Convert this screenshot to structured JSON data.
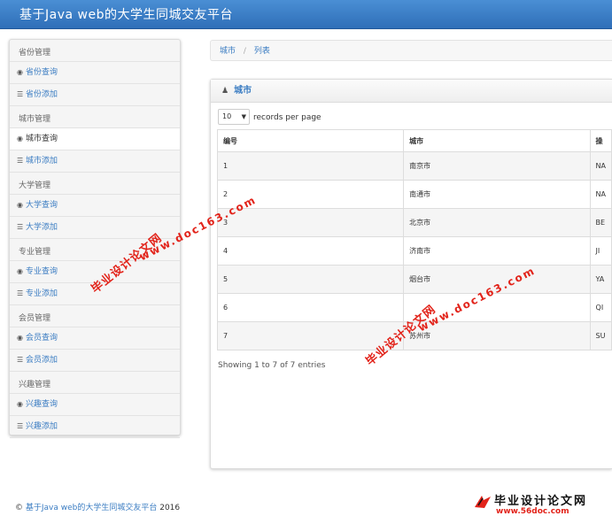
{
  "header": {
    "title": "基于Java web的大学生同城交友平台"
  },
  "sidebar": {
    "groups": [
      {
        "title": "省份管理",
        "items": [
          "省份查询",
          "省份添加"
        ]
      },
      {
        "title": "城市管理",
        "items": [
          "城市查询",
          "城市添加"
        ]
      },
      {
        "title": "大学管理",
        "items": [
          "大学查询",
          "大学添加"
        ]
      },
      {
        "title": "专业管理",
        "items": [
          "专业查询",
          "专业添加"
        ]
      },
      {
        "title": "会员管理",
        "items": [
          "会员查询",
          "会员添加"
        ]
      },
      {
        "title": "兴趣管理",
        "items": [
          "兴趣查询",
          "兴趣添加"
        ]
      }
    ],
    "active_item": "城市查询"
  },
  "breadcrumb": {
    "items": [
      "城市",
      "列表"
    ],
    "separator": "/"
  },
  "panel": {
    "title": "城市",
    "page_length": "10",
    "records_label": "records per page",
    "columns": [
      "编号",
      "城市",
      "操"
    ],
    "rows": [
      [
        "1",
        "南京市",
        "NA"
      ],
      [
        "2",
        "南通市",
        "NA"
      ],
      [
        "3",
        "北京市",
        "BE"
      ],
      [
        "4",
        "济南市",
        "JI"
      ],
      [
        "5",
        "烟台市",
        "YA"
      ],
      [
        "6",
        "",
        "QI"
      ],
      [
        "7",
        "苏州市",
        "SU"
      ]
    ],
    "info": "Showing 1 to 7 of 7 entries"
  },
  "footer": {
    "copyright": "©",
    "link_text": "基于Java web的大学生同城交友平台",
    "year": "2016"
  },
  "watermarks": {
    "cn": "毕业设计论文网",
    "url": "www.doc163.com"
  },
  "logo": {
    "text": "毕业设计论文网",
    "url": "www.56doc.com"
  },
  "icons": {
    "view": "eye-icon",
    "add": "list-icon",
    "user": "user-icon",
    "caret": "caret-down-icon"
  },
  "colors": {
    "header": "#3a7cc2",
    "link": "#3a7cc2",
    "watermark": "#e2231a"
  }
}
